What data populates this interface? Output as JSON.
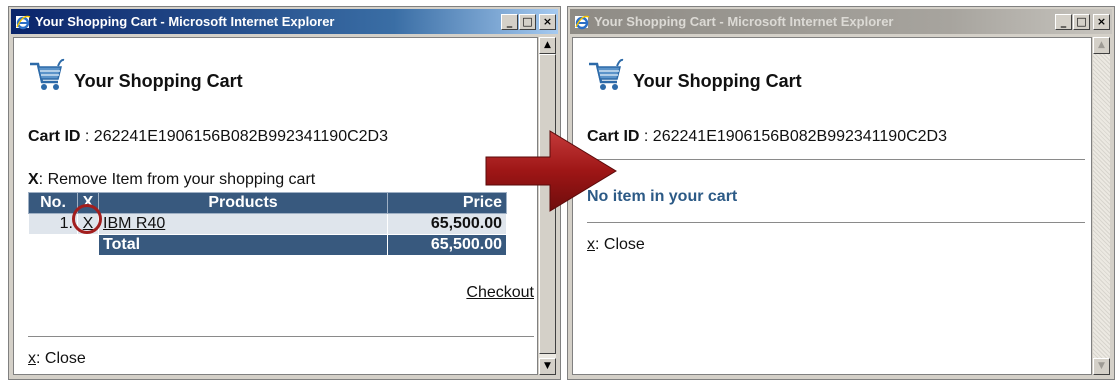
{
  "left_window": {
    "title": "Your Shopping Cart - Microsoft Internet Explorer",
    "cart_title": "Your Shopping Cart",
    "cart_id_label": "Cart ID",
    "cart_id_value": ": 262241E1906156B082B992341190C2D3",
    "remove_note_key": "X",
    "remove_note_text": ": Remove Item from your shopping cart",
    "table": {
      "headers": [
        "No.",
        "X",
        "Products",
        "Price"
      ],
      "rows": [
        {
          "no": "1.",
          "x": "X",
          "product": "IBM R40",
          "price": "65,500.00"
        }
      ],
      "total_label": "Total",
      "total_value": "65,500.00"
    },
    "checkout_label": "Checkout",
    "close_key": "x",
    "close_text": ": Close"
  },
  "right_window": {
    "title": "Your Shopping Cart - Microsoft Internet Explorer",
    "cart_title": "Your Shopping Cart",
    "cart_id_label": "Cart ID",
    "cart_id_value": ": 262241E1906156B082B992341190C2D3",
    "empty_message": "No item in your cart",
    "close_key": "x",
    "close_text": ": Close"
  },
  "titlebar_buttons": {
    "minimize": "_",
    "maximize": "□",
    "close": "×"
  },
  "scroll_arrows": {
    "up": "▲",
    "down": "▼"
  },
  "colors": {
    "header_blue": "#38597e",
    "row_light": "#dfe5ec",
    "empty_message": "#2c5a86",
    "annotation_red": "#a21e1e"
  },
  "icons": [
    "ie-icon",
    "shopping-cart-icon",
    "arrow-annotation"
  ]
}
